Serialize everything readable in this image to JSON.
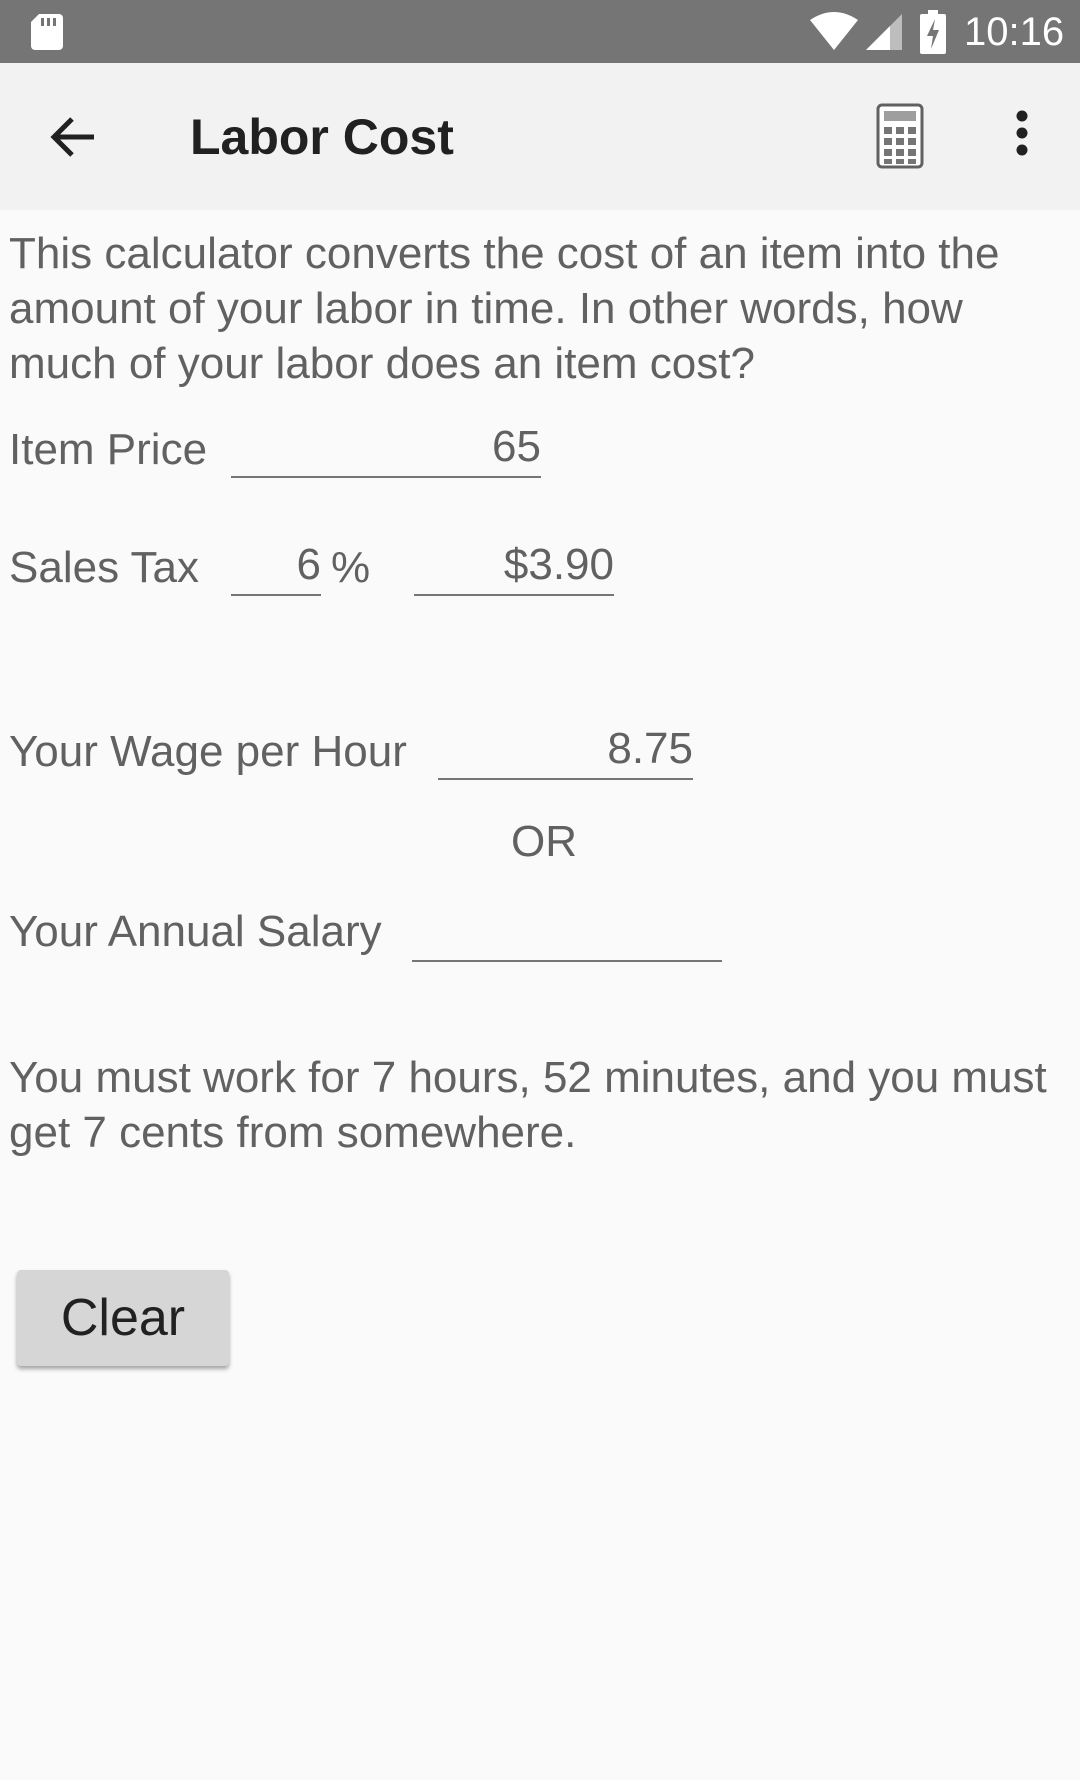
{
  "status_bar": {
    "time": "10:16",
    "icons": [
      "sd-card-icon",
      "wifi-icon",
      "signal-icon",
      "battery-charging-icon"
    ]
  },
  "app_bar": {
    "title": "Labor Cost",
    "icons": [
      "back-arrow-icon",
      "calculator-icon",
      "more-vert-icon"
    ]
  },
  "intro_text": "This calculator converts the cost of an item into the amount of your labor in time. In other words, how much of your labor does an item cost?",
  "form": {
    "item_price": {
      "label": "Item Price",
      "value": "65"
    },
    "sales_tax": {
      "label": "Sales Tax",
      "percent_value": "6",
      "percent_sign": "%",
      "amount": "$3.90"
    },
    "wage": {
      "label": "Your Wage per Hour",
      "value": "8.75"
    },
    "or_label": "OR",
    "salary": {
      "label": "Your Annual Salary",
      "value": ""
    }
  },
  "result_text": "You must work for 7 hours, 52 minutes, and you must get 7 cents from somewhere.",
  "clear_label": "Clear",
  "colors": {
    "status_bar": "#757575",
    "app_bar": "#f2f2f2",
    "background": "#fafafa",
    "text_secondary": "#616161",
    "text_primary": "#212121",
    "button": "#d6d6d6"
  }
}
